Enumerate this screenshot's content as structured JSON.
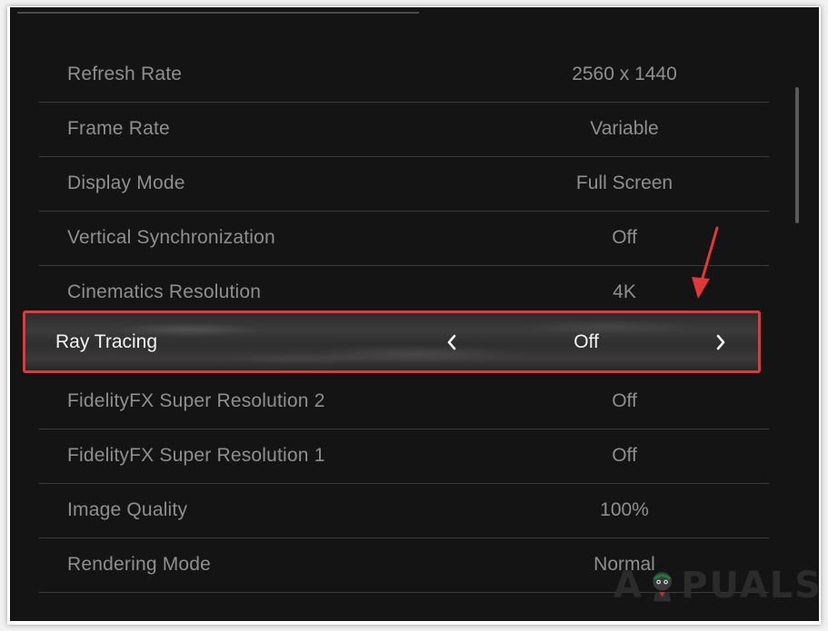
{
  "settings": [
    {
      "label": "Refresh Rate",
      "value": "2560 x 1440"
    },
    {
      "label": "Frame Rate",
      "value": "Variable"
    },
    {
      "label": "Display Mode",
      "value": "Full Screen"
    },
    {
      "label": "Vertical Synchronization",
      "value": "Off"
    },
    {
      "label": "Cinematics Resolution",
      "value": "4K"
    },
    {
      "label": "Ray Tracing",
      "value": "Off"
    },
    {
      "label": "FidelityFX Super Resolution 2",
      "value": "Off"
    },
    {
      "label": "FidelityFX Super Resolution 1",
      "value": "Off"
    },
    {
      "label": "Image Quality",
      "value": "100%"
    },
    {
      "label": "Rendering Mode",
      "value": "Normal"
    }
  ],
  "selected_index": 5,
  "icons": {
    "prev": "chevron-left-icon",
    "next": "chevron-right-icon",
    "annotation": "red-arrow-icon"
  },
  "colors": {
    "background": "#141414",
    "text_dim": "#8f8f8f",
    "text_selected": "#f2f2f2",
    "highlight_border": "#e0383d"
  },
  "watermark": {
    "prefix": "A",
    "suffix": "PUALS"
  }
}
